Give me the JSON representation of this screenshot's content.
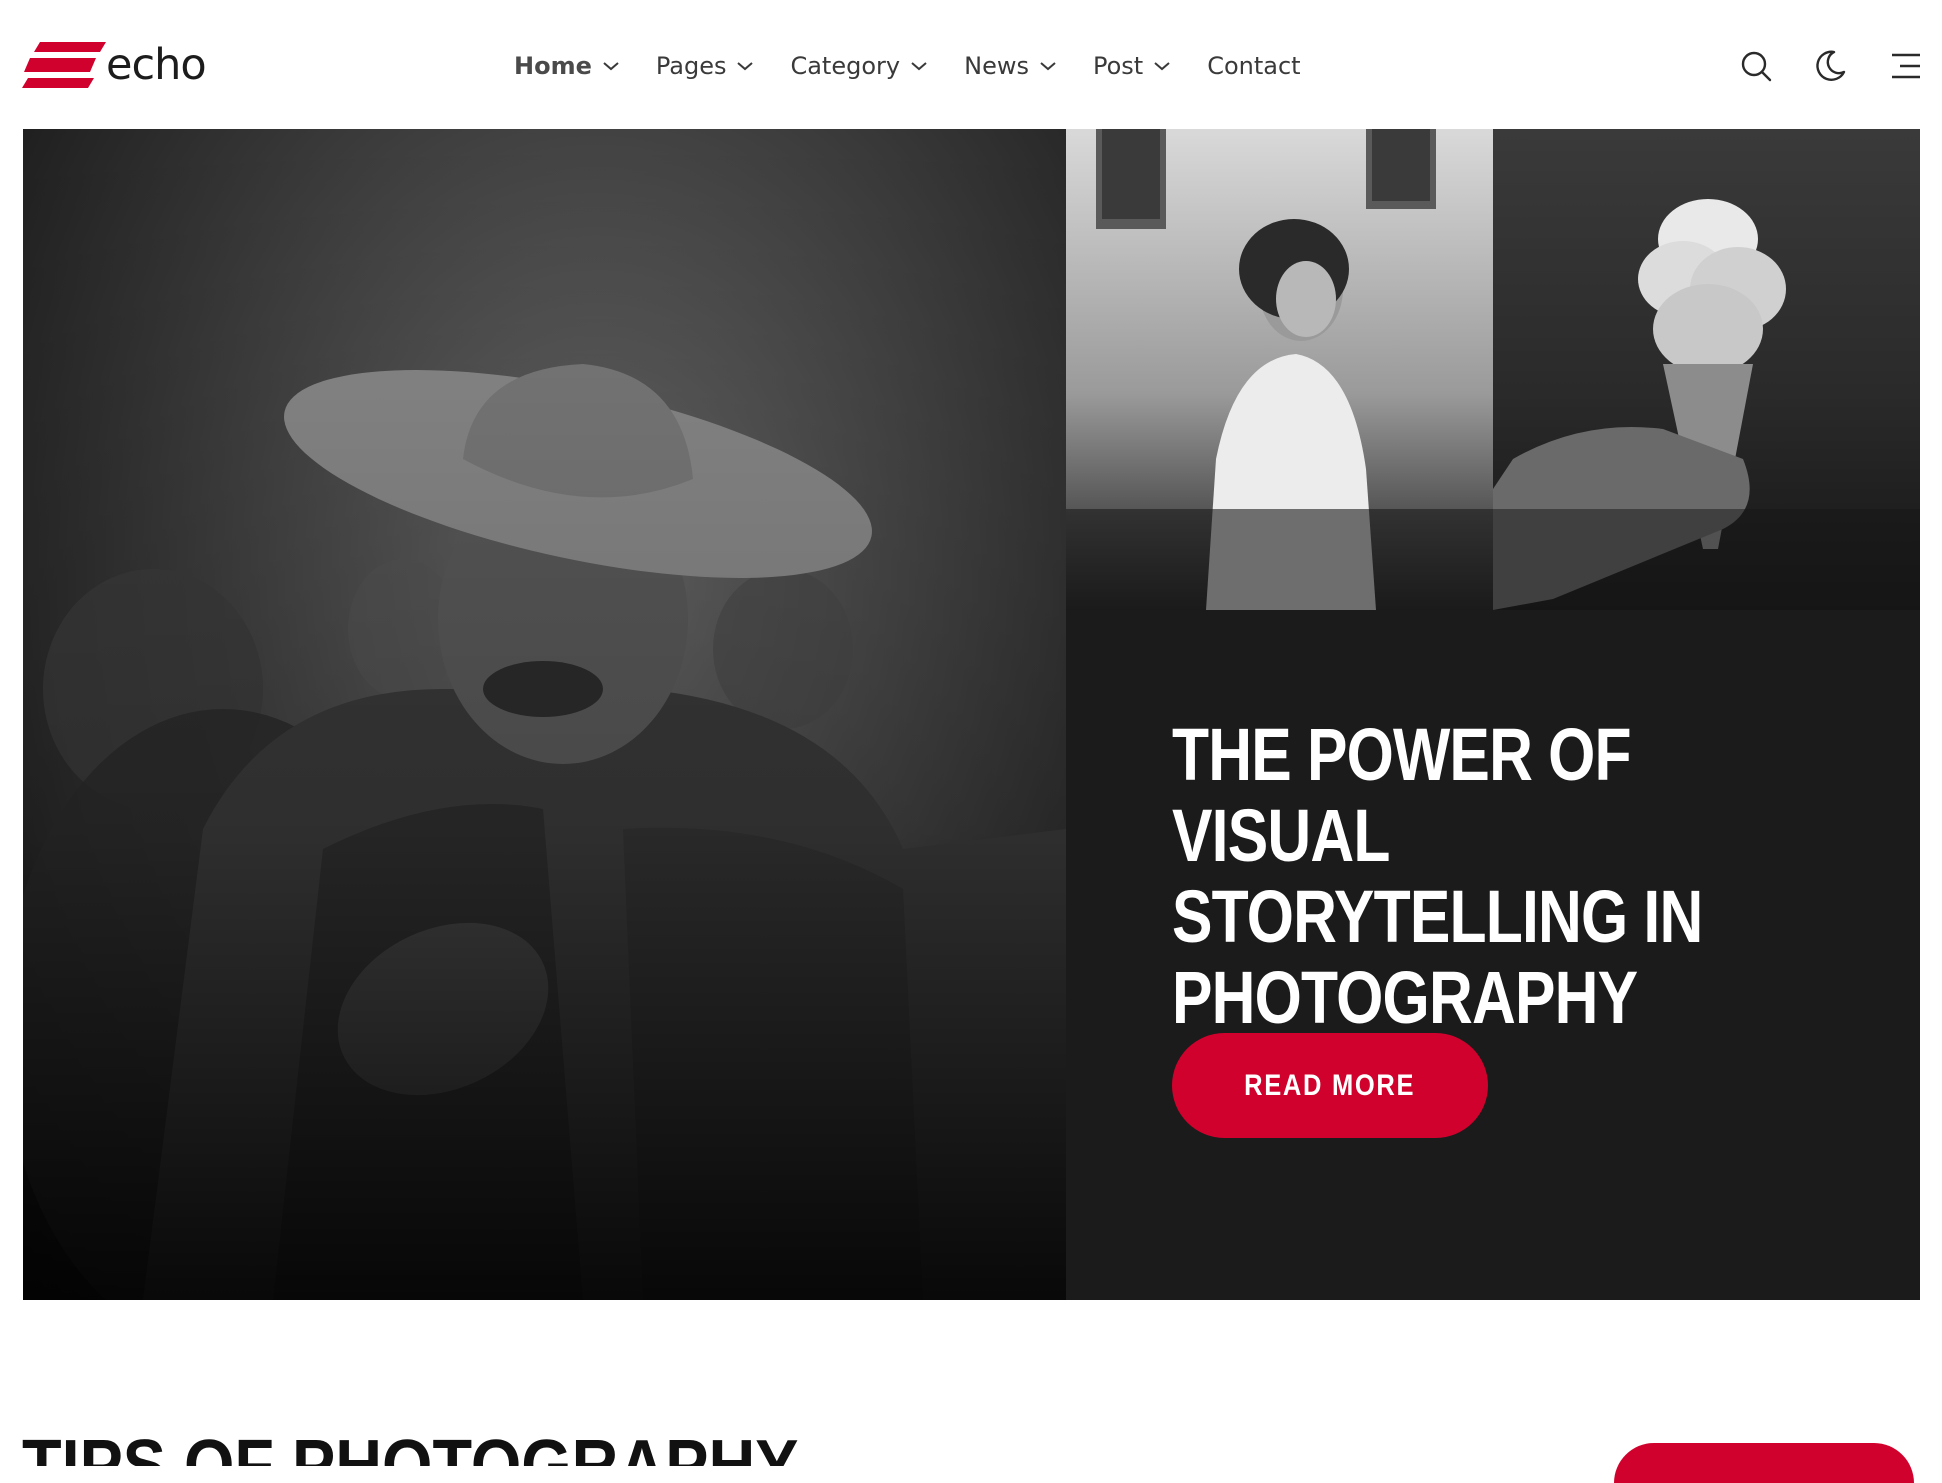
{
  "brand": {
    "name": "echo",
    "accent": "#d0022d"
  },
  "nav": {
    "items": [
      {
        "label": "Home",
        "has_dropdown": true,
        "active": true
      },
      {
        "label": "Pages",
        "has_dropdown": true,
        "active": false
      },
      {
        "label": "Category",
        "has_dropdown": true,
        "active": false
      },
      {
        "label": "News",
        "has_dropdown": true,
        "active": false
      },
      {
        "label": "Post",
        "has_dropdown": true,
        "active": false
      },
      {
        "label": "Contact",
        "has_dropdown": false,
        "active": false
      }
    ]
  },
  "header_icons": [
    "search-icon",
    "moon-icon",
    "menu-icon"
  ],
  "hero": {
    "title": "The Power of Visual Storytelling in Photography",
    "button_label": "Read More",
    "images": [
      "portrait-man-hat",
      "woman-white-dress",
      "ice-cream-cloud-cone"
    ]
  },
  "section": {
    "title": "Tips of Photography"
  }
}
